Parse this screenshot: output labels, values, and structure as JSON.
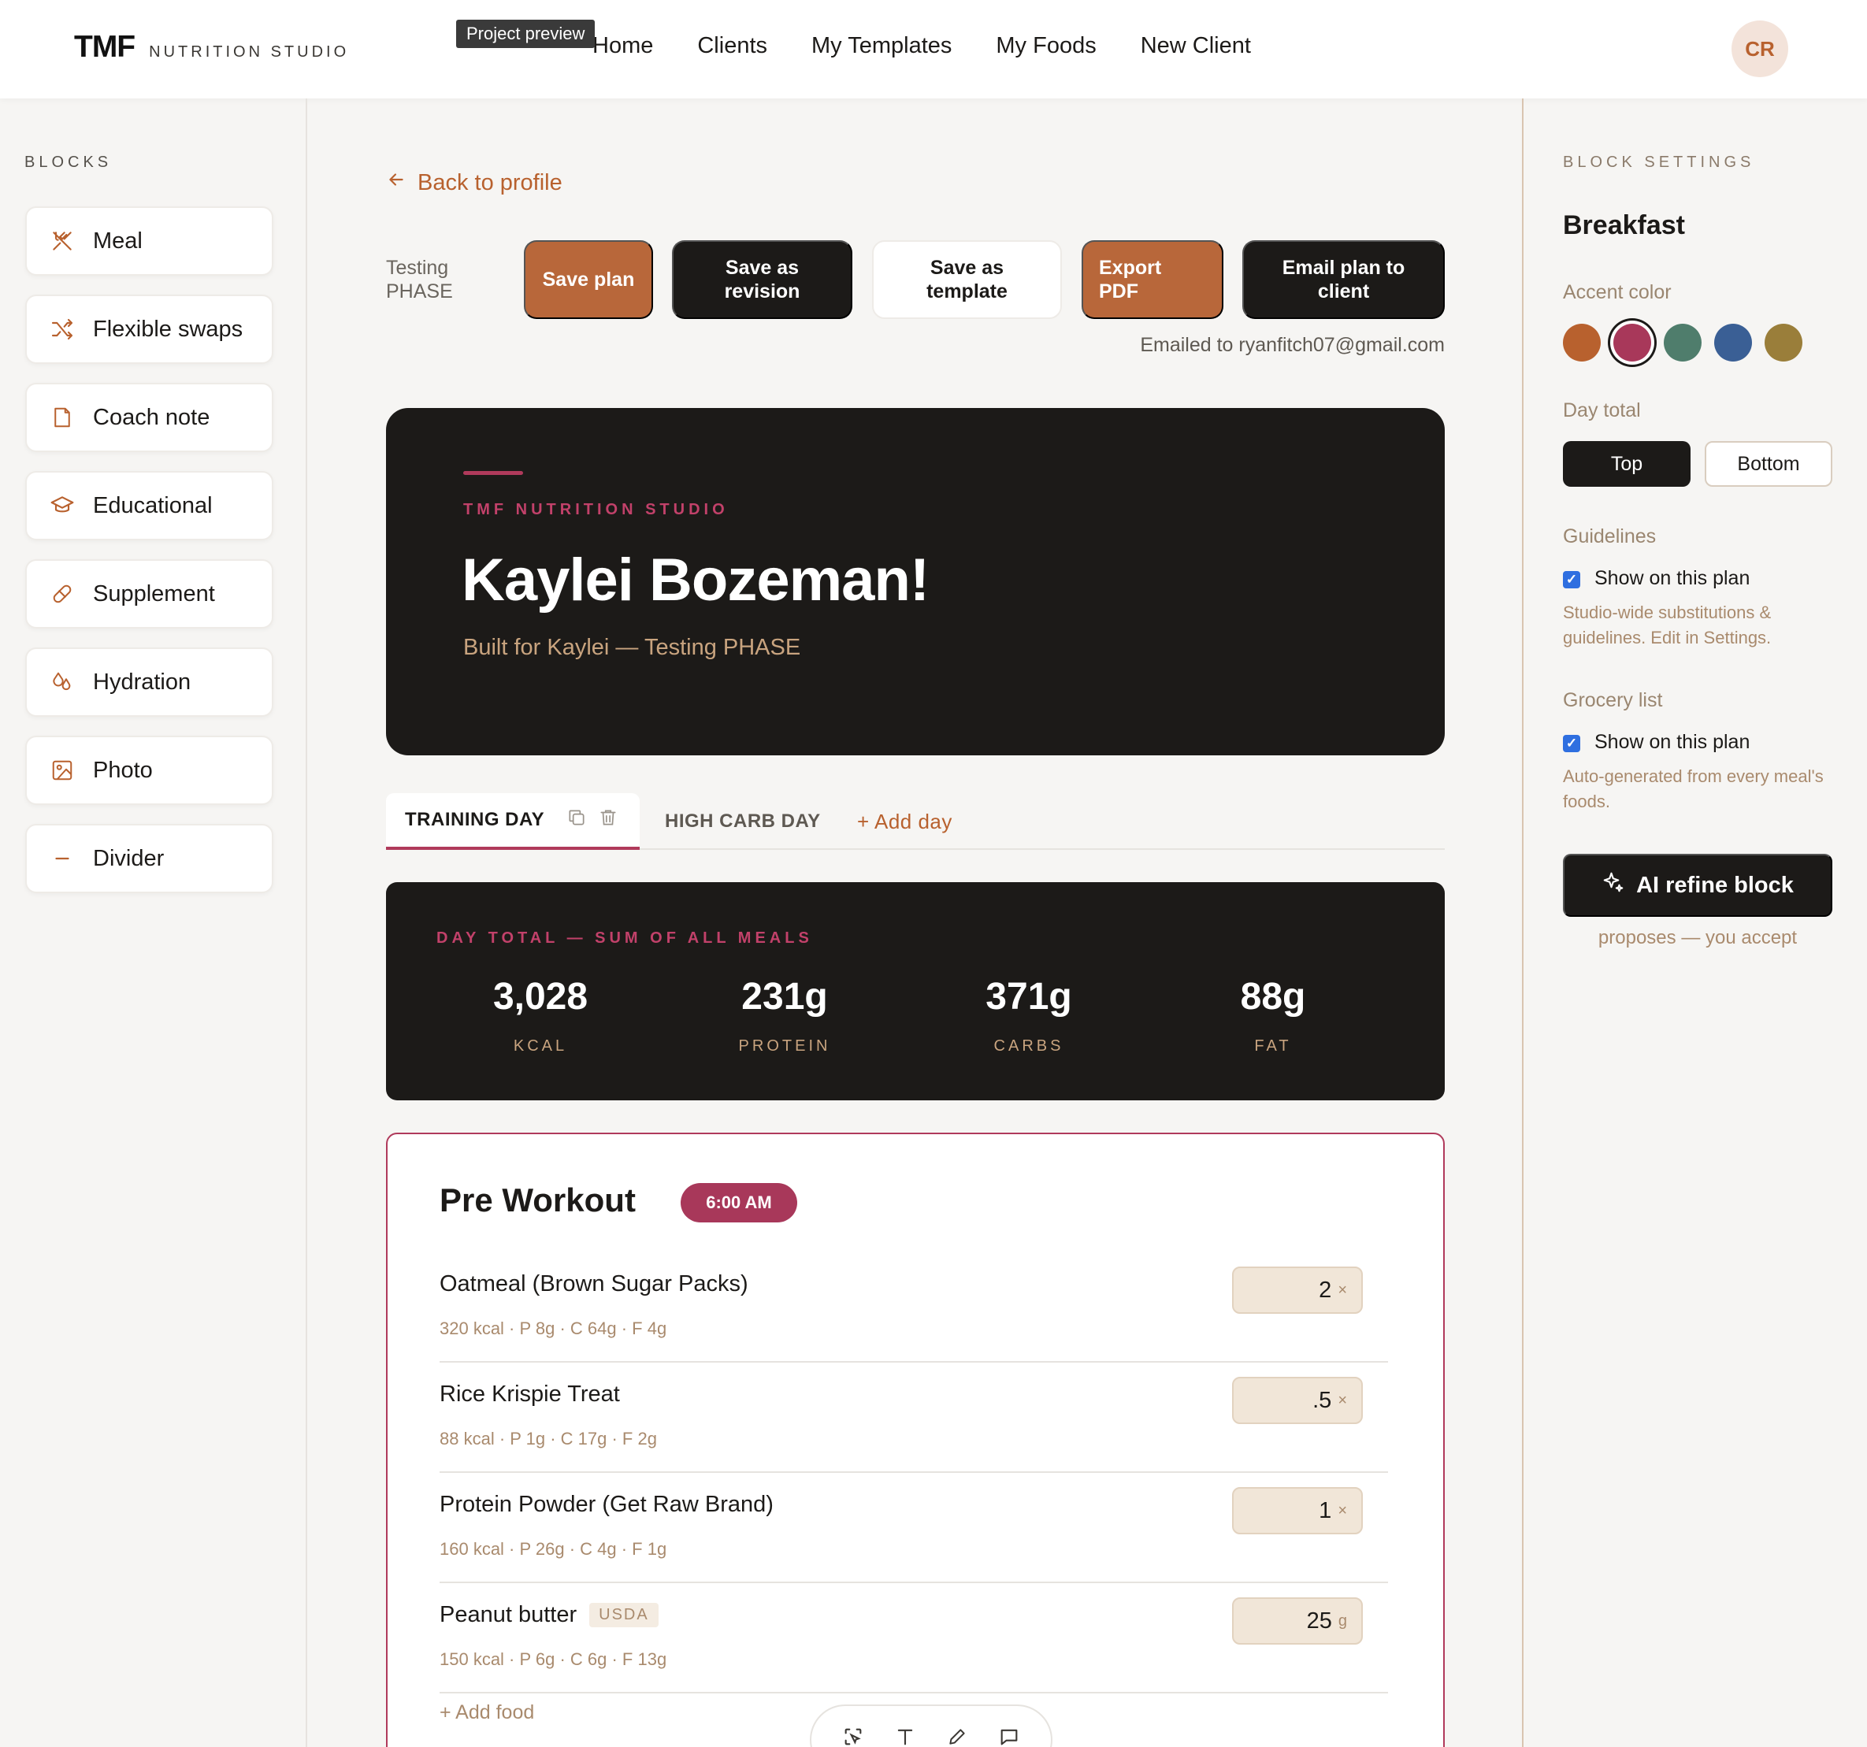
{
  "app": {
    "logo_mark": "TMF",
    "logo_sub": "NUTRITION STUDIO",
    "tooltip": "Project preview",
    "nav": [
      "Home",
      "Clients",
      "My Templates",
      "My Foods",
      "New Client"
    ],
    "avatar_initials": "CR"
  },
  "left_sidebar": {
    "title": "BLOCKS",
    "items": [
      {
        "label": "Meal",
        "icon": "utensils-crossed-icon"
      },
      {
        "label": "Flexible swaps",
        "icon": "shuffle-icon"
      },
      {
        "label": "Coach note",
        "icon": "note-icon"
      },
      {
        "label": "Educational",
        "icon": "graduation-cap-icon"
      },
      {
        "label": "Supplement",
        "icon": "pill-icon"
      },
      {
        "label": "Hydration",
        "icon": "droplets-icon"
      },
      {
        "label": "Photo",
        "icon": "image-icon"
      },
      {
        "label": "Divider",
        "icon": "minus-icon"
      }
    ]
  },
  "header": {
    "back_label": "Back to profile",
    "phase_label": "Testing PHASE",
    "buttons": {
      "save_plan": "Save plan",
      "save_revision": "Save as revision",
      "save_template": "Save as template",
      "export_pdf": "Export PDF",
      "email_plan": "Email plan to client"
    },
    "emailed_status": "Emailed to ryanfitch07@gmail.com"
  },
  "hero": {
    "studio": "TMF NUTRITION STUDIO",
    "client_name": "Kaylei Bozeman!",
    "subtitle": "Built for Kaylei — Testing PHASE"
  },
  "tabs": {
    "active": "TRAINING DAY",
    "second": "HIGH CARB DAY",
    "add": "+ Add day"
  },
  "day_total": {
    "label": "DAY TOTAL — SUM OF ALL MEALS",
    "stats": [
      {
        "value": "3,028",
        "label": "KCAL"
      },
      {
        "value": "231g",
        "label": "PROTEIN"
      },
      {
        "value": "371g",
        "label": "CARBS"
      },
      {
        "value": "88g",
        "label": "FAT"
      }
    ]
  },
  "meal": {
    "title": "Pre Workout",
    "time": "6:00 AM",
    "foods": [
      {
        "name": "Oatmeal (Brown Sugar Packs)",
        "macros": "320 kcal · P 8g · C 64g · F 4g",
        "qty": "2",
        "unit": "×",
        "tag": ""
      },
      {
        "name": "Rice Krispie Treat",
        "macros": "88 kcal · P 1g · C 17g · F 2g",
        "qty": ".5",
        "unit": "×",
        "tag": ""
      },
      {
        "name": "Protein Powder (Get Raw Brand)",
        "macros": "160 kcal · P 26g · C 4g · F 1g",
        "qty": "1",
        "unit": "×",
        "tag": ""
      },
      {
        "name": "Peanut butter",
        "macros": "150 kcal · P 6g · C 6g · F 13g",
        "qty": "25",
        "unit": "g",
        "tag": "USDA"
      }
    ],
    "add_food": "Add food"
  },
  "right_sidebar": {
    "title": "BLOCK SETTINGS",
    "block_name": "Breakfast",
    "accent_label": "Accent color",
    "accent_colors": [
      "#b8612e",
      "#a8385a",
      "#4f7d6c",
      "#3a5f95",
      "#9a7e3a"
    ],
    "selected_accent": "#a8385a",
    "day_total_label": "Day total",
    "day_total_options": [
      "Top",
      "Bottom"
    ],
    "day_total_selected": "Top",
    "guidelines_label": "Guidelines",
    "guidelines_check": "Show on this plan",
    "guidelines_help": "Studio-wide substitutions & guidelines. Edit in Settings.",
    "grocery_label": "Grocery list",
    "grocery_check": "Show on this plan",
    "grocery_help": "Auto-generated from every meal's foods.",
    "ai_button": "AI refine block",
    "ai_help": "proposes — you accept"
  },
  "colors": {
    "accent_orange": "#b8673a",
    "accent_berry": "#b03a5b",
    "dark": "#1c1a18"
  }
}
